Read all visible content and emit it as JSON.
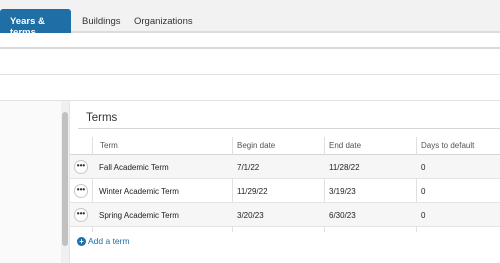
{
  "tabs": [
    {
      "label": "Years & terms",
      "active": true
    },
    {
      "label": "Buildings",
      "active": false
    },
    {
      "label": "Organizations",
      "active": false
    }
  ],
  "section": {
    "title": "Terms"
  },
  "table": {
    "columns": [
      "Term",
      "Begin date",
      "End date",
      "Days to default"
    ],
    "rows": [
      {
        "more": "•••",
        "term": "Fall Academic Term",
        "begin": "7/1/22",
        "end": "11/28/22",
        "days": "0"
      },
      {
        "more": "•••",
        "term": "Winter Academic Term",
        "begin": "11/29/22",
        "end": "3/19/23",
        "days": "0"
      },
      {
        "more": "•••",
        "term": "Spring Academic Term",
        "begin": "3/20/23",
        "end": "6/30/23",
        "days": "0"
      }
    ]
  },
  "add_term": {
    "icon": "+",
    "label": "Add a term"
  },
  "colors": {
    "accent": "#1f6fa6",
    "row_alt": "#f6f6f6"
  }
}
